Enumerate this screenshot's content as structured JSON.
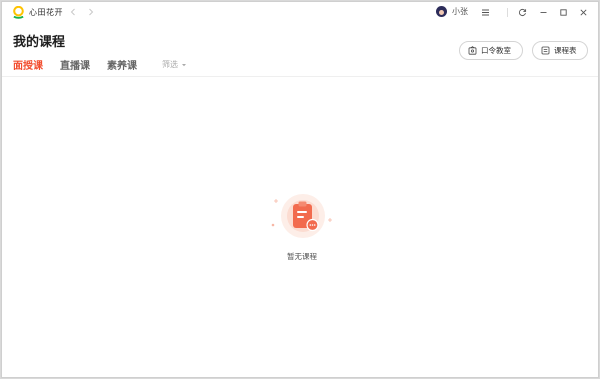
{
  "app": {
    "name": "心田花开"
  },
  "user": {
    "name": "小张"
  },
  "header": {
    "title": "我的课程",
    "buttons": {
      "code_classroom": "口令教室",
      "schedule": "课程表"
    }
  },
  "tabs": [
    {
      "label": "面授课",
      "active": true
    },
    {
      "label": "直播课",
      "active": false
    },
    {
      "label": "素养课",
      "active": false
    }
  ],
  "filter": {
    "label": "筛选"
  },
  "empty_state": {
    "text": "暂无课程",
    "icon": "clipboard-icon"
  },
  "colors": {
    "accent": "#f24e2f",
    "brand_green": "#19b24b",
    "brand_yellow": "#ffc300"
  }
}
